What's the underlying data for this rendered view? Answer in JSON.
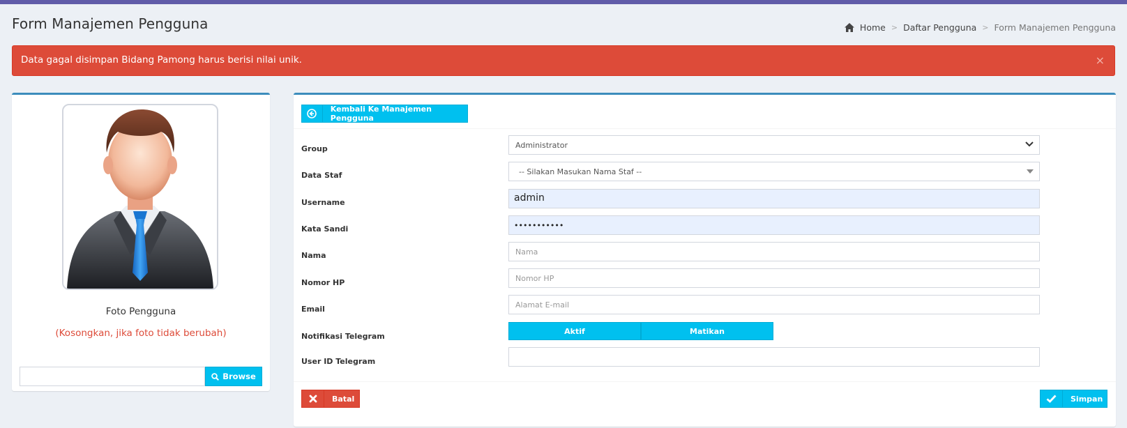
{
  "header": {
    "title": "Form Manajemen Pengguna",
    "breadcrumb": {
      "home": "Home",
      "list": "Daftar Pengguna",
      "current": "Form Manajemen Pengguna",
      "separator": ">"
    }
  },
  "alert": {
    "message": "Data gagal disimpan Bidang Pamong harus berisi nilai unik.",
    "close": "×"
  },
  "photo": {
    "label": "Foto Pengguna",
    "hint": "(Kosongkan, jika foto tidak berubah)",
    "browse_label": "Browse"
  },
  "form": {
    "back_label": "Kembali Ke Manajemen Pengguna",
    "group": {
      "label": "Group",
      "value": "Administrator"
    },
    "staf": {
      "label": "Data Staf",
      "value": "-- Silakan Masukan Nama Staf --"
    },
    "username": {
      "label": "Username",
      "value": "admin"
    },
    "password": {
      "label": "Kata Sandi",
      "value": "•••••••••••"
    },
    "nama": {
      "label": "Nama",
      "placeholder": "Nama"
    },
    "hp": {
      "label": "Nomor HP",
      "placeholder": "Nomor HP"
    },
    "email": {
      "label": "Email",
      "placeholder": "Alamat E-mail"
    },
    "telegram": {
      "label": "Notifikasi Telegram",
      "on": "Aktif",
      "off": "Matikan"
    },
    "telegram_id": {
      "label": "User ID Telegram",
      "value": ""
    },
    "cancel_label": "Batal",
    "save_label": "Simpan"
  },
  "colors": {
    "topbar": "#605ca8",
    "alert": "#dd4b39",
    "info": "#00c0ef",
    "box_border": "#3c8dbc"
  }
}
